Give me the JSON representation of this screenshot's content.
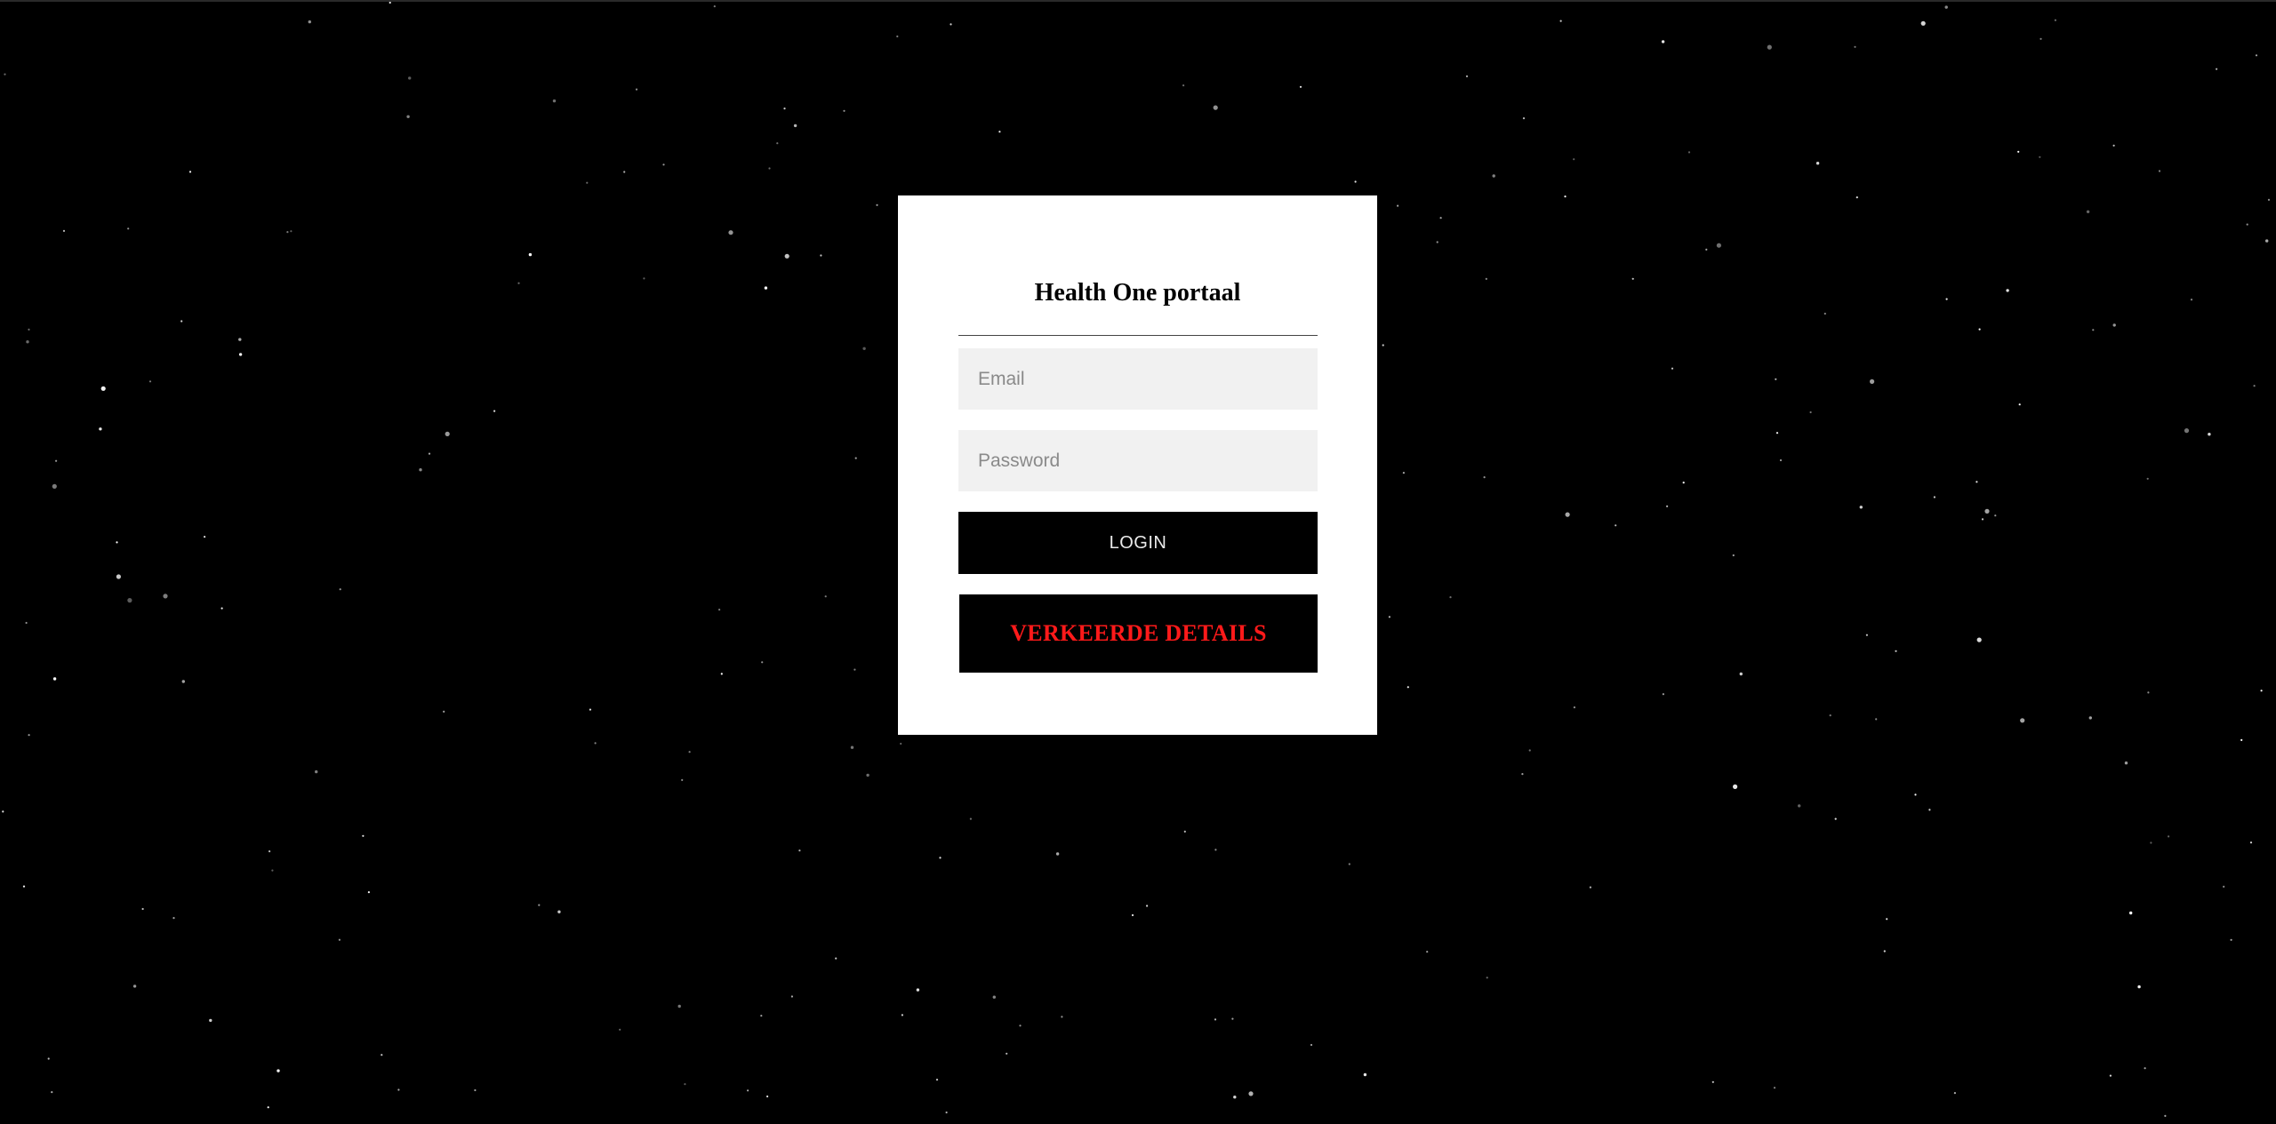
{
  "login": {
    "title": "Health One portaal",
    "email_placeholder": "Email",
    "password_placeholder": "Password",
    "login_label": "LOGIN",
    "error_message": "VERKEERDE DETAILS"
  },
  "colors": {
    "background": "#000000",
    "card": "#ffffff",
    "field": "#f1f1f1",
    "button": "#000000",
    "error_text": "#ff1a1a",
    "stars": "#ffffff"
  }
}
